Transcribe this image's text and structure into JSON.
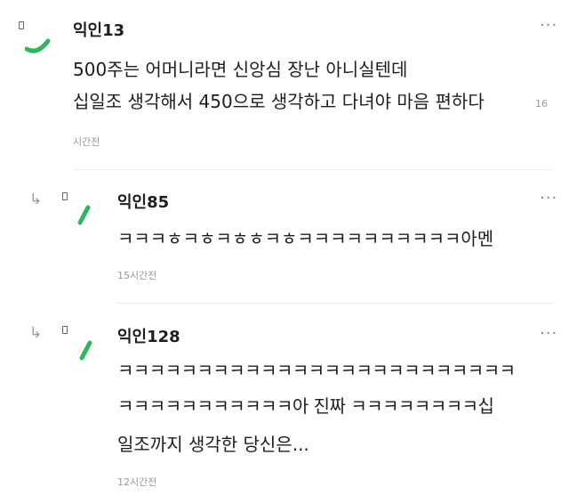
{
  "colors": {
    "accent": "#2fb65c",
    "text": "#1e1e1e",
    "meta": "#999999"
  },
  "comments": [
    {
      "author": "익인13",
      "lines": [
        "500주는 어머니라면 신앙심 장난 아니실텐데",
        "십일조 생각해서 450으로 생각하고 다녀야 마음 편하다"
      ],
      "likes": "16",
      "time": "시간전",
      "more_icon": "more-dots-icon"
    },
    {
      "author": "익인85",
      "lines": [
        "ㅋㅋㅋㅎㅋㅎㅋㅎㅎㅋㅎㅋㅋㅋㅋㅋㅋㅋㅋㅋㅋ아멘"
      ],
      "time": "15시간전",
      "reply_icon": "reply-arrow-icon",
      "more_icon": "more-dots-icon"
    },
    {
      "author": "익인128",
      "lines": [
        "ㅋㅋㅋㅋㅋㅋㅋㅋㅋㅋㅋㅋㅋㅋㅋㅋㅋㅋㅋㅋㅋㅋㅋㅋㅋ",
        "ㅋㅋㅋㅋㅋㅋㅋㅋㅋㅋㅋ아 진짜 ㅋㅋㅋㅋㅋㅋㅋㅋ십",
        "일조까지 생각한 당신은..."
      ],
      "time": "12시간전",
      "reply_icon": "reply-arrow-icon",
      "more_icon": "more-dots-icon"
    }
  ]
}
